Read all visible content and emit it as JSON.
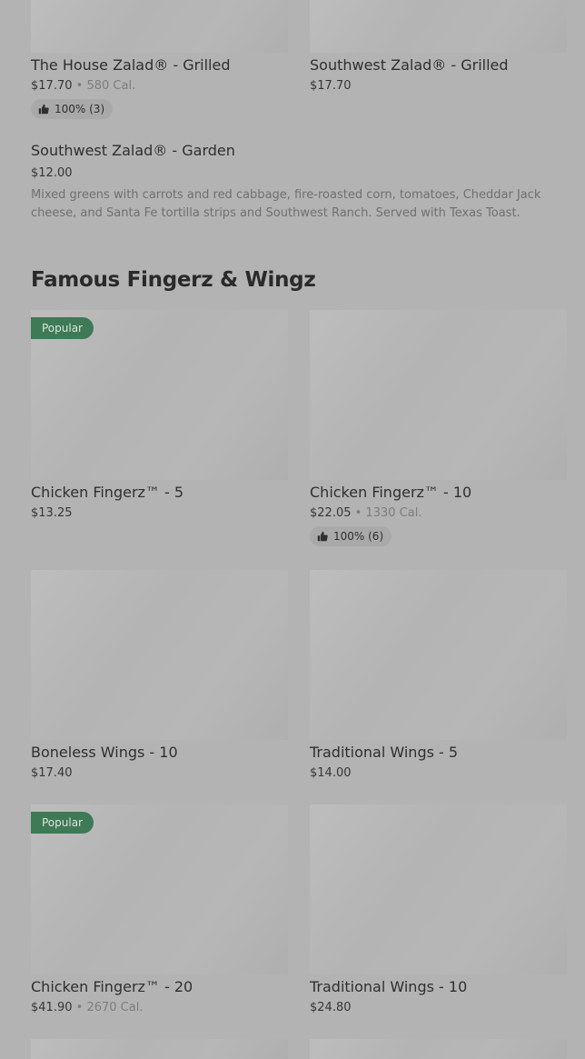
{
  "rating_icon": "thumbs-up-icon",
  "badge_color": "#3e7a55",
  "top_items": [
    {
      "name": "The House Zalad® - Grilled",
      "price": "$17.70",
      "calories": "580 Cal.",
      "rating": "100% (3)"
    },
    {
      "name": "Southwest Zalad® - Grilled",
      "price": "$17.70"
    }
  ],
  "garden_item": {
    "name": "Southwest Zalad® - Garden",
    "price": "$12.00",
    "description": "Mixed greens with carrots and red cabbage, fire-roasted corn, tomatoes, Cheddar Jack cheese, and Santa Fe tortilla strips and Southwest Ranch. Served with Texas Toast."
  },
  "section": {
    "title": "Famous Fingerz & Wingz"
  },
  "items": [
    {
      "name": "Chicken Fingerz™ - 5",
      "price": "$13.25",
      "badge": "Popular"
    },
    {
      "name": "Chicken Fingerz™ - 10",
      "price": "$22.05",
      "calories": "1330 Cal.",
      "rating": "100% (6)"
    },
    {
      "name": "Boneless Wings - 10",
      "price": "$17.40"
    },
    {
      "name": "Traditional Wings - 5",
      "price": "$14.00"
    },
    {
      "name": "Chicken Fingerz™ - 20",
      "price": "$41.90",
      "calories": "2670 Cal.",
      "badge": "Popular"
    },
    {
      "name": "Traditional Wings - 10",
      "price": "$24.80"
    }
  ],
  "separator": "•"
}
